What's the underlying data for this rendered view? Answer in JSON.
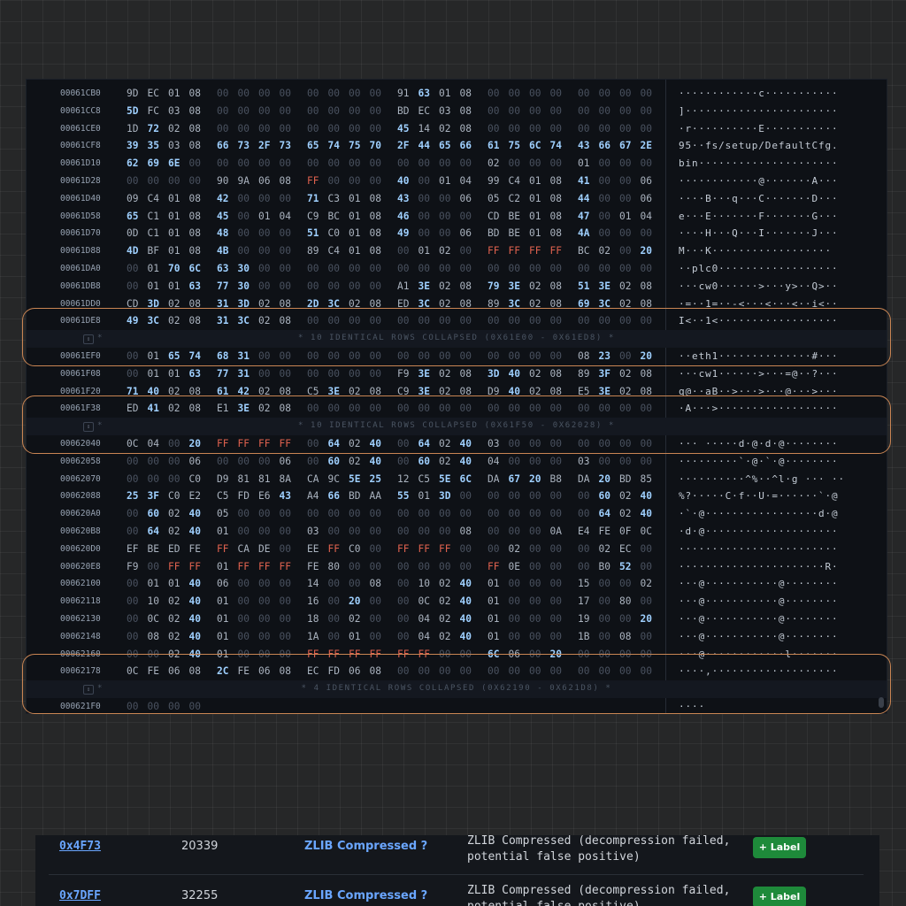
{
  "hex_view": {
    "rows": [
      {
        "offset": "00061CB0",
        "bytes": [
          "9D",
          "EC",
          "01",
          "08",
          "00",
          "00",
          "00",
          "00",
          "00",
          "00",
          "00",
          "00",
          "91",
          "63",
          "01",
          "08",
          "00",
          "00",
          "00",
          "00",
          "00",
          "00",
          "00",
          "00"
        ],
        "ascii": "············c···········"
      },
      {
        "offset": "00061CC8",
        "bytes": [
          "5D",
          "FC",
          "03",
          "08",
          "00",
          "00",
          "00",
          "00",
          "00",
          "00",
          "00",
          "00",
          "BD",
          "EC",
          "03",
          "08",
          "00",
          "00",
          "00",
          "00",
          "00",
          "00",
          "00",
          "00"
        ],
        "ascii": "]·······················"
      },
      {
        "offset": "00061CE0",
        "bytes": [
          "1D",
          "72",
          "02",
          "08",
          "00",
          "00",
          "00",
          "00",
          "00",
          "00",
          "00",
          "00",
          "45",
          "14",
          "02",
          "08",
          "00",
          "00",
          "00",
          "00",
          "00",
          "00",
          "00",
          "00"
        ],
        "ascii": "·r··········E···········"
      },
      {
        "offset": "00061CF8",
        "bytes": [
          "39",
          "35",
          "03",
          "08",
          "66",
          "73",
          "2F",
          "73",
          "65",
          "74",
          "75",
          "70",
          "2F",
          "44",
          "65",
          "66",
          "61",
          "75",
          "6C",
          "74",
          "43",
          "66",
          "67",
          "2E"
        ],
        "ascii": "95··fs/setup/DefaultCfg."
      },
      {
        "offset": "00061D10",
        "bytes": [
          "62",
          "69",
          "6E",
          "00",
          "00",
          "00",
          "00",
          "00",
          "00",
          "00",
          "00",
          "00",
          "00",
          "00",
          "00",
          "00",
          "02",
          "00",
          "00",
          "00",
          "01",
          "00",
          "00",
          "00"
        ],
        "ascii": "bin·····················"
      },
      {
        "offset": "00061D28",
        "bytes": [
          "00",
          "00",
          "00",
          "00",
          "90",
          "9A",
          "06",
          "08",
          "FF",
          "00",
          "00",
          "00",
          "40",
          "00",
          "01",
          "04",
          "99",
          "C4",
          "01",
          "08",
          "41",
          "00",
          "00",
          "06"
        ],
        "ascii": "············@·······A···"
      },
      {
        "offset": "00061D40",
        "bytes": [
          "09",
          "C4",
          "01",
          "08",
          "42",
          "00",
          "00",
          "00",
          "71",
          "C3",
          "01",
          "08",
          "43",
          "00",
          "00",
          "06",
          "05",
          "C2",
          "01",
          "08",
          "44",
          "00",
          "00",
          "06"
        ],
        "ascii": "····B···q···C·······D···"
      },
      {
        "offset": "00061D58",
        "bytes": [
          "65",
          "C1",
          "01",
          "08",
          "45",
          "00",
          "01",
          "04",
          "C9",
          "BC",
          "01",
          "08",
          "46",
          "00",
          "00",
          "00",
          "CD",
          "BE",
          "01",
          "08",
          "47",
          "00",
          "01",
          "04"
        ],
        "ascii": "e···E·······F·······G···"
      },
      {
        "offset": "00061D70",
        "bytes": [
          "0D",
          "C1",
          "01",
          "08",
          "48",
          "00",
          "00",
          "00",
          "51",
          "C0",
          "01",
          "08",
          "49",
          "00",
          "00",
          "06",
          "BD",
          "BE",
          "01",
          "08",
          "4A",
          "00",
          "00",
          "00"
        ],
        "ascii": "····H···Q···I·······J···"
      },
      {
        "offset": "00061D88",
        "bytes": [
          "4D",
          "BF",
          "01",
          "08",
          "4B",
          "00",
          "00",
          "00",
          "89",
          "C4",
          "01",
          "08",
          "00",
          "01",
          "02",
          "00",
          "FF",
          "FF",
          "FF",
          "FF",
          "BC",
          "02",
          "00",
          "20"
        ],
        "ascii": "M···K··················"
      },
      {
        "offset": "00061DA0",
        "bytes": [
          "00",
          "01",
          "70",
          "6C",
          "63",
          "30",
          "00",
          "00",
          "00",
          "00",
          "00",
          "00",
          "00",
          "00",
          "00",
          "00",
          "00",
          "00",
          "00",
          "00",
          "00",
          "00",
          "00",
          "00"
        ],
        "ascii": "··plc0··················"
      },
      {
        "offset": "00061DB8",
        "bytes": [
          "00",
          "01",
          "01",
          "63",
          "77",
          "30",
          "00",
          "00",
          "00",
          "00",
          "00",
          "00",
          "A1",
          "3E",
          "02",
          "08",
          "79",
          "3E",
          "02",
          "08",
          "51",
          "3E",
          "02",
          "08"
        ],
        "ascii": "···cw0······>···y>··Q>··"
      },
      {
        "offset": "00061DD0",
        "bytes": [
          "CD",
          "3D",
          "02",
          "08",
          "31",
          "3D",
          "02",
          "08",
          "2D",
          "3C",
          "02",
          "08",
          "ED",
          "3C",
          "02",
          "08",
          "89",
          "3C",
          "02",
          "08",
          "69",
          "3C",
          "02",
          "08"
        ],
        "ascii": "·=··1=··-<···<···<··i<··"
      },
      {
        "offset": "00061DE8",
        "bytes": [
          "49",
          "3C",
          "02",
          "08",
          "31",
          "3C",
          "02",
          "08",
          "00",
          "00",
          "00",
          "00",
          "00",
          "00",
          "00",
          "00",
          "00",
          "00",
          "00",
          "00",
          "00",
          "00",
          "00",
          "00"
        ],
        "ascii": "I<··1<··················"
      },
      {
        "collapsed": "10 IDENTICAL ROWS COLLAPSED (0X61E00 - 0X61ED8)"
      },
      {
        "offset": "00061EF0",
        "bytes": [
          "00",
          "01",
          "65",
          "74",
          "68",
          "31",
          "00",
          "00",
          "00",
          "00",
          "00",
          "00",
          "00",
          "00",
          "00",
          "00",
          "00",
          "00",
          "00",
          "00",
          "08",
          "23",
          "00",
          "20"
        ],
        "ascii": "··eth1··············#···"
      },
      {
        "offset": "00061F08",
        "bytes": [
          "00",
          "01",
          "01",
          "63",
          "77",
          "31",
          "00",
          "00",
          "00",
          "00",
          "00",
          "00",
          "F9",
          "3E",
          "02",
          "08",
          "3D",
          "40",
          "02",
          "08",
          "89",
          "3F",
          "02",
          "08"
        ],
        "ascii": "···cw1······>···=@··?···"
      },
      {
        "offset": "00061F20",
        "bytes": [
          "71",
          "40",
          "02",
          "08",
          "61",
          "42",
          "02",
          "08",
          "C5",
          "3E",
          "02",
          "08",
          "C9",
          "3E",
          "02",
          "08",
          "D9",
          "40",
          "02",
          "08",
          "E5",
          "3E",
          "02",
          "08"
        ],
        "ascii": "q@··aB··>···>···@···>···"
      },
      {
        "offset": "00061F38",
        "bytes": [
          "ED",
          "41",
          "02",
          "08",
          "E1",
          "3E",
          "02",
          "08",
          "00",
          "00",
          "00",
          "00",
          "00",
          "00",
          "00",
          "00",
          "00",
          "00",
          "00",
          "00",
          "00",
          "00",
          "00",
          "00"
        ],
        "ascii": "·A···>··················"
      },
      {
        "collapsed": "10 IDENTICAL ROWS COLLAPSED (0X61F50 - 0X62028)"
      },
      {
        "offset": "00062040",
        "bytes": [
          "0C",
          "04",
          "00",
          "20",
          "FF",
          "FF",
          "FF",
          "FF",
          "00",
          "64",
          "02",
          "40",
          "00",
          "64",
          "02",
          "40",
          "03",
          "00",
          "00",
          "00",
          "00",
          "00",
          "00",
          "00"
        ],
        "ascii": "··· ·····d·@·d·@········"
      },
      {
        "offset": "00062058",
        "bytes": [
          "00",
          "00",
          "00",
          "06",
          "00",
          "00",
          "00",
          "06",
          "00",
          "60",
          "02",
          "40",
          "00",
          "60",
          "02",
          "40",
          "04",
          "00",
          "00",
          "00",
          "03",
          "00",
          "00",
          "00"
        ],
        "ascii": "·········`·@·`·@········"
      },
      {
        "offset": "00062070",
        "bytes": [
          "00",
          "00",
          "00",
          "C0",
          "D9",
          "81",
          "81",
          "8A",
          "CA",
          "9C",
          "5E",
          "25",
          "12",
          "C5",
          "5E",
          "6C",
          "DA",
          "67",
          "20",
          "B8",
          "DA",
          "20",
          "BD",
          "85"
        ],
        "ascii": "··········^%··^l·g ··· ··"
      },
      {
        "offset": "00062088",
        "bytes": [
          "25",
          "3F",
          "C0",
          "E2",
          "C5",
          "FD",
          "E6",
          "43",
          "A4",
          "66",
          "BD",
          "AA",
          "55",
          "01",
          "3D",
          "00",
          "00",
          "00",
          "00",
          "00",
          "00",
          "60",
          "02",
          "40"
        ],
        "ascii": "%?·····C·f··U·=······`·@"
      },
      {
        "offset": "000620A0",
        "bytes": [
          "00",
          "60",
          "02",
          "40",
          "05",
          "00",
          "00",
          "00",
          "00",
          "00",
          "00",
          "00",
          "00",
          "00",
          "00",
          "00",
          "00",
          "00",
          "00",
          "00",
          "00",
          "64",
          "02",
          "40"
        ],
        "ascii": "·`·@·················d·@"
      },
      {
        "offset": "000620B8",
        "bytes": [
          "00",
          "64",
          "02",
          "40",
          "01",
          "00",
          "00",
          "00",
          "03",
          "00",
          "00",
          "00",
          "00",
          "00",
          "00",
          "08",
          "00",
          "00",
          "00",
          "0A",
          "E4",
          "FE",
          "0F",
          "0C"
        ],
        "ascii": "·d·@····················"
      },
      {
        "offset": "000620D0",
        "bytes": [
          "EF",
          "BE",
          "ED",
          "FE",
          "FF",
          "CA",
          "DE",
          "00",
          "EE",
          "FF",
          "C0",
          "00",
          "FF",
          "FF",
          "FF",
          "00",
          "00",
          "02",
          "00",
          "00",
          "00",
          "02",
          "EC",
          "00"
        ],
        "ascii": "························"
      },
      {
        "offset": "000620E8",
        "bytes": [
          "F9",
          "00",
          "FF",
          "FF",
          "01",
          "FF",
          "FF",
          "FF",
          "FE",
          "80",
          "00",
          "00",
          "00",
          "00",
          "00",
          "00",
          "FF",
          "0E",
          "00",
          "00",
          "00",
          "B0",
          "52",
          "00"
        ],
        "ascii": "······················R·"
      },
      {
        "offset": "00062100",
        "bytes": [
          "00",
          "01",
          "01",
          "40",
          "06",
          "00",
          "00",
          "00",
          "14",
          "00",
          "00",
          "08",
          "00",
          "10",
          "02",
          "40",
          "01",
          "00",
          "00",
          "00",
          "15",
          "00",
          "00",
          "02"
        ],
        "ascii": "···@···········@········"
      },
      {
        "offset": "00062118",
        "bytes": [
          "00",
          "10",
          "02",
          "40",
          "01",
          "00",
          "00",
          "00",
          "16",
          "00",
          "20",
          "00",
          "00",
          "0C",
          "02",
          "40",
          "01",
          "00",
          "00",
          "00",
          "17",
          "00",
          "80",
          "00"
        ],
        "ascii": "···@···········@········"
      },
      {
        "offset": "00062130",
        "bytes": [
          "00",
          "0C",
          "02",
          "40",
          "01",
          "00",
          "00",
          "00",
          "18",
          "00",
          "02",
          "00",
          "00",
          "04",
          "02",
          "40",
          "01",
          "00",
          "00",
          "00",
          "19",
          "00",
          "00",
          "20"
        ],
        "ascii": "···@···········@········"
      },
      {
        "offset": "00062148",
        "bytes": [
          "00",
          "08",
          "02",
          "40",
          "01",
          "00",
          "00",
          "00",
          "1A",
          "00",
          "01",
          "00",
          "00",
          "04",
          "02",
          "40",
          "01",
          "00",
          "00",
          "00",
          "1B",
          "00",
          "08",
          "00"
        ],
        "ascii": "···@···········@········"
      },
      {
        "offset": "00062160",
        "bytes": [
          "00",
          "00",
          "02",
          "40",
          "01",
          "00",
          "00",
          "00",
          "FF",
          "FF",
          "FF",
          "FF",
          "FF",
          "FF",
          "00",
          "00",
          "6C",
          "06",
          "00",
          "20",
          "00",
          "00",
          "00",
          "00"
        ],
        "ascii": "···@············l·······"
      },
      {
        "offset": "00062178",
        "bytes": [
          "0C",
          "FE",
          "06",
          "08",
          "2C",
          "FE",
          "06",
          "08",
          "EC",
          "FD",
          "06",
          "08",
          "00",
          "00",
          "00",
          "00",
          "00",
          "00",
          "00",
          "00",
          "00",
          "00",
          "00",
          "00"
        ],
        "ascii": "····,···················"
      },
      {
        "collapsed": "4 IDENTICAL ROWS COLLAPSED (0X62190 - 0X621D8)"
      },
      {
        "offset": "000621F0",
        "bytes": [
          "00",
          "00",
          "00",
          "00"
        ],
        "ascii": "····"
      }
    ]
  },
  "results": [
    {
      "offset": "0x4F73",
      "decimal": "20339",
      "type": "ZLIB Compressed ?",
      "description": "ZLIB Compressed (decompression failed, potential false positive)",
      "label_button": "+ Label"
    },
    {
      "offset": "0x7DFF",
      "decimal": "32255",
      "type": "ZLIB Compressed ?",
      "description": "ZLIB Compressed (decompression failed, potential false positive)",
      "label_button": "+ Label"
    }
  ],
  "colors": {
    "background": "#262728",
    "panel": "#0e1116",
    "byte_high": "#9fd0ff",
    "byte_ff": "#e0624f",
    "highlight_outline": "#c98553",
    "label_button": "#1e8a3a",
    "link": "#6aa6ff"
  }
}
